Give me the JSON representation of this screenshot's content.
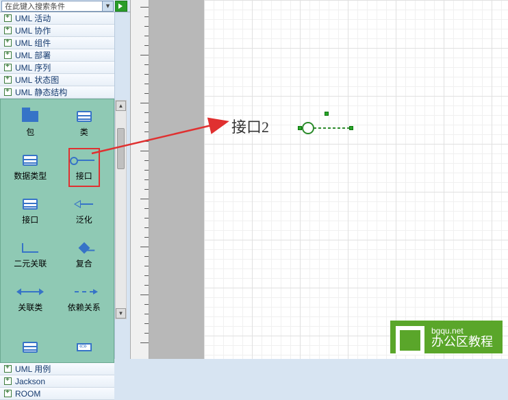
{
  "search": {
    "placeholder": "在此键入搜索条件"
  },
  "tree": {
    "items": [
      "UML 活动",
      "UML 协作",
      "UML 组件",
      "UML 部署",
      "UML 序列",
      "UML 状态图",
      "UML 静态结构"
    ],
    "bottom_items": [
      "UML 用例",
      "Jackson",
      "ROOM"
    ]
  },
  "stencil": {
    "items": [
      {
        "label": "包"
      },
      {
        "label": "类"
      },
      {
        "label": "数据类型"
      },
      {
        "label": "接口"
      },
      {
        "label": "接口"
      },
      {
        "label": "泛化"
      },
      {
        "label": "二元关联"
      },
      {
        "label": "复合"
      },
      {
        "label": "关联类"
      },
      {
        "label": "依赖关系"
      }
    ]
  },
  "canvas": {
    "shape_label": "接口2"
  },
  "watermark": {
    "url": "bgqu.net",
    "text": "办公区教程"
  }
}
